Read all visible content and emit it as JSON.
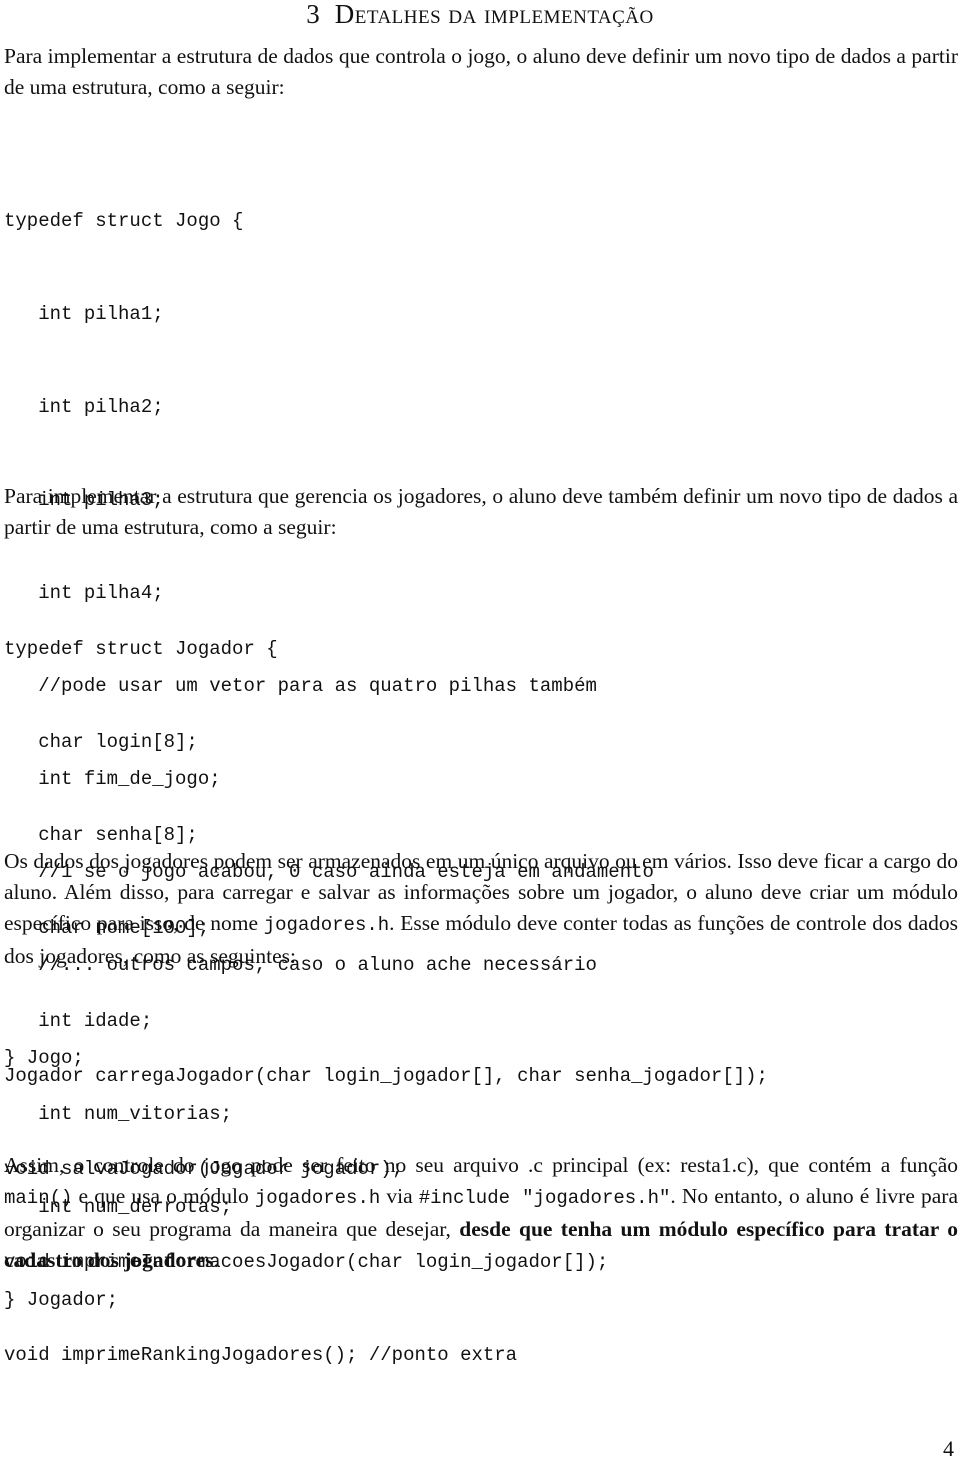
{
  "section": {
    "number": "3",
    "title": "Detalhes da implementação"
  },
  "paragraphs": {
    "p1": "Para implementar a estrutura de dados que controla o jogo, o aluno deve definir um novo tipo de dados a partir de uma estrutura, como a seguir:",
    "p2": "Para implementar a estrutura que gerencia os jogadores, o aluno deve também definir um novo tipo de dados a partir de uma estrutura, como a seguir:",
    "p3": {
      "text1": "Os dados dos jogadores podem ser armazenados em um único arquivo ou em vários. Isso deve ficar a cargo do aluno. Além disso, para carregar e salvar as informações sobre um jogador, o aluno deve criar um módulo específico para isso, de nome ",
      "code1": "jogadores.h",
      "text2": ". Esse módulo deve conter todas as funções de controle dos dados dos jogadores, como as seguintes:"
    },
    "p4": {
      "text1": "Assim, o controle do jogo pode ser feito no seu arquivo .c principal (ex: resta1.c), que contém a função ",
      "code1": "main()",
      "text2": " e que usa o módulo ",
      "code2": "jogadores.h",
      "text3": " via ",
      "code3": "#include \"jogadores.h\"",
      "text4": ". No entanto, o aluno é livre para organizar o seu programa da maneira que desejar, ",
      "bold": "desde que tenha um módulo específico para tratar o cadastro dos jogadores",
      "text5": "."
    }
  },
  "code_blocks": {
    "jogo_struct": [
      "typedef struct Jogo {",
      "   int pilha1;",
      "   int pilha2;",
      "   int pilha3;",
      "   int pilha4;",
      "   //pode usar um vetor para as quatro pilhas também",
      "   int fim_de_jogo;",
      "   //1 se o jogo acabou, 0 caso ainda esteja em andamento",
      "   //... outros campos, caso o aluno ache necessário",
      "} Jogo;"
    ],
    "jogador_struct": [
      "typedef struct Jogador {",
      "   char login[8];",
      "   char senha[8];",
      "   char nome[100];",
      "   int idade;",
      "   int num_vitorias;",
      "   int num_derrotas;",
      "} Jogador;"
    ],
    "functions": [
      "Jogador carregaJogador(char login_jogador[], char senha_jogador[]);",
      "void salvaJogador(Jogador jogador);",
      "void imprimeInformacoesJogador(char login_jogador[]);",
      "void imprimeRankingJogadores(); //ponto extra"
    ]
  },
  "page_number": "4"
}
